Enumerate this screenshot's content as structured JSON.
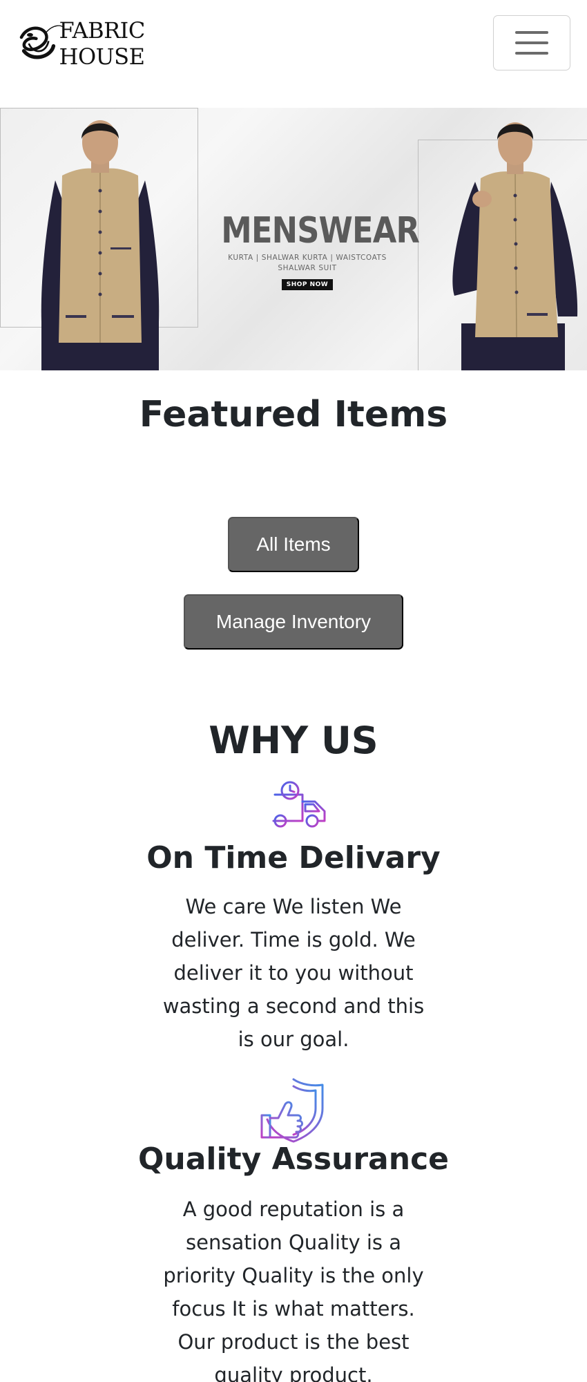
{
  "navbar": {
    "brand_name": "FABRIC HOUSE",
    "brand_logo_icon": "thread-spool-logo",
    "menu_icon": "hamburger-menu-icon"
  },
  "hero": {
    "title": "MENSWEAR",
    "subtitle_line1": "KURTA  |  SHALWAR KURTA  |  WAISTCOATS",
    "subtitle_line2": "SHALWAR SUIT",
    "shop_label": "SHOP NOW"
  },
  "featured": {
    "title": "Featured Items",
    "all_items_label": "All Items",
    "manage_inventory_label": "Manage Inventory"
  },
  "why_us": {
    "title": "WHY US",
    "features": [
      {
        "icon": "delivery-truck-icon",
        "heading": "On Time Delivary",
        "text": "We care We listen We deliver. Time is gold. We deliver it to you without wasting a second and this is our goal."
      },
      {
        "icon": "quality-shield-icon",
        "heading": "Quality Assurance",
        "text": "A good reputation is a sensation Quality is a priority Quality is the only focus It is what matters. Our product is the best quality product."
      }
    ]
  },
  "colors": {
    "button_bg": "#666666",
    "icon_gradient_start": "#c03fc4",
    "icon_gradient_end": "#4a63e8"
  }
}
